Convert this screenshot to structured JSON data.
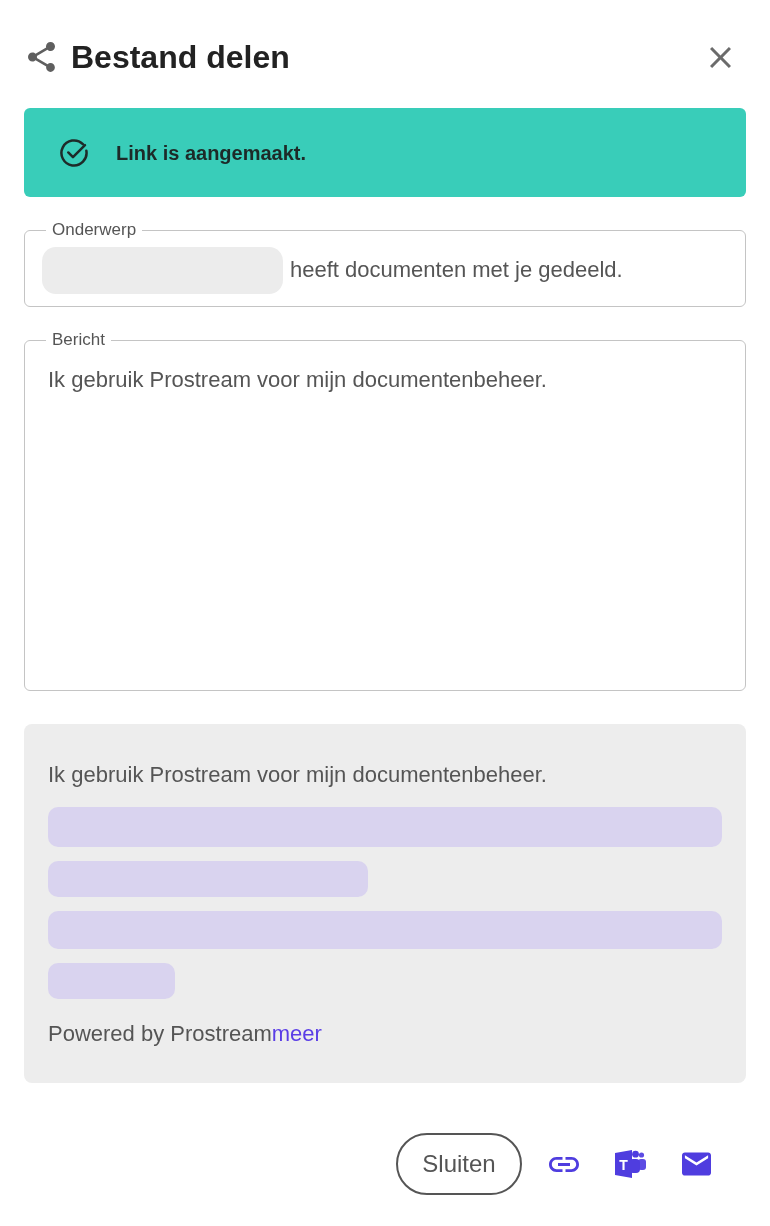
{
  "dialog": {
    "title": "Bestand delen"
  },
  "banner": {
    "kind": "success",
    "message": "Link is aangemaakt."
  },
  "subject": {
    "label": "Onderwerp",
    "redacted": true,
    "value": "heeft documenten met je gedeeld."
  },
  "message": {
    "label": "Bericht",
    "value": "Ik gebruik Prostream voor mijn documentenbeheer."
  },
  "preview": {
    "text": "Ik gebruik Prostream voor mijn documentenbeheer.",
    "links_redacted": true,
    "footer": "Powered by Prostream",
    "footer_link": "meer"
  },
  "actions": [
    {
      "kind": "text",
      "label": "Sluiten"
    },
    {
      "kind": "link"
    },
    {
      "kind": "chat",
      "glyph": "T"
    },
    {
      "kind": "mail"
    }
  ]
}
